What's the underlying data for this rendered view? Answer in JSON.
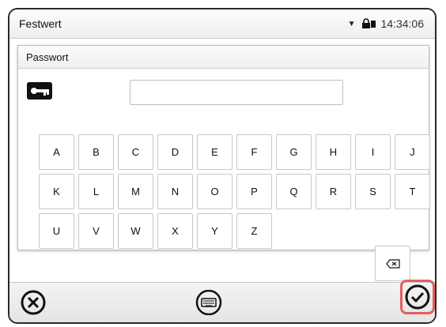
{
  "status": {
    "title": "Festwert",
    "time": "14:34:06"
  },
  "dialog": {
    "title": "Passwort",
    "password_value": "",
    "password_placeholder": ""
  },
  "keyboard": {
    "row1": [
      "A",
      "B",
      "C",
      "D",
      "E",
      "F",
      "G",
      "H",
      "I",
      "J"
    ],
    "row2": [
      "K",
      "L",
      "M",
      "N",
      "O",
      "P",
      "Q",
      "R",
      "S",
      "T"
    ],
    "row3": [
      "U",
      "V",
      "W",
      "X",
      "Y",
      "Z"
    ]
  },
  "icons": {
    "status_dropdown": "chevron-down-icon",
    "status_lock": "lock-icon",
    "key": "key-icon",
    "backspace": "backspace-icon",
    "cancel": "cancel-icon",
    "keyboard": "keyboard-icon",
    "confirm": "check-icon"
  },
  "colors": {
    "highlight": "#e0605f"
  }
}
